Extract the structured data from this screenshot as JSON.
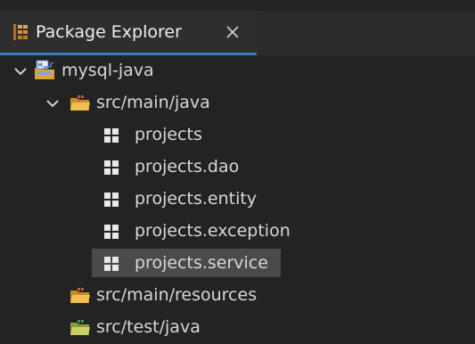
{
  "view": {
    "tab_title": "Package Explorer",
    "close_glyph": "×"
  },
  "tree": {
    "project": "mysql-java",
    "src_main_java": "src/main/java",
    "packages": [
      "projects",
      "projects.dao",
      "projects.entity",
      "projects.exception",
      "projects.service"
    ],
    "src_main_resources": "src/main/resources",
    "src_test_java": "src/test/java"
  },
  "icons": {
    "package": "package-icon",
    "folder": "source-folder-icon",
    "project": "maven-project-icon",
    "chevron": "chevron-down-icon"
  },
  "colors": {
    "background": "#232323",
    "selection": "#4a4a4a",
    "tab_underline": "#3a78c7"
  }
}
